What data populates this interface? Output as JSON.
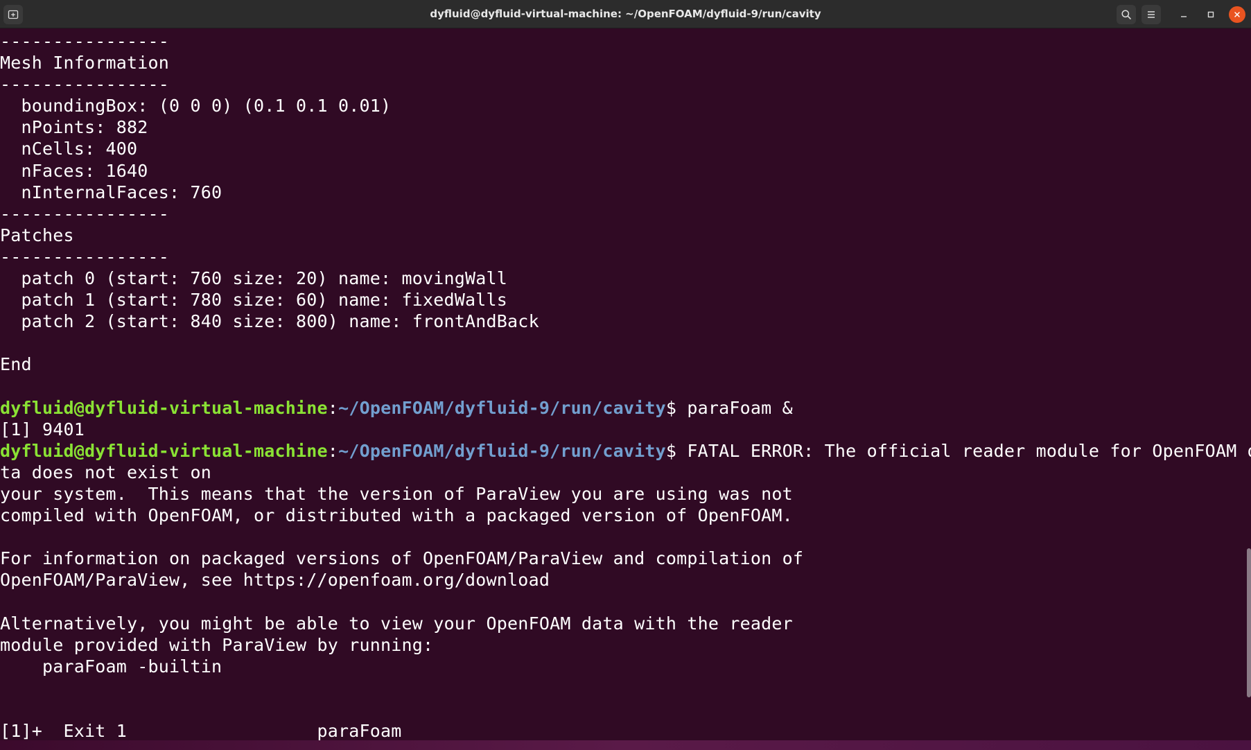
{
  "window": {
    "title": "dyfluid@dyfluid-virtual-machine: ~/OpenFOAM/dyfluid-9/run/cavity"
  },
  "titlebar": {
    "new_tab_icon": "new-tab-icon",
    "search_icon": "search-icon",
    "menu_icon": "hamburger-menu-icon",
    "minimize_icon": "minimize-icon",
    "maximize_icon": "maximize-icon",
    "close_icon": "close-icon",
    "close_color": "#e95420"
  },
  "colors": {
    "background": "#300a24",
    "text": "#ffffff",
    "prompt_user": "#8ae234",
    "prompt_path": "#729fcf"
  },
  "terminal": {
    "lines": [
      {
        "text": "----------------"
      },
      {
        "text": "Mesh Information"
      },
      {
        "text": "----------------"
      },
      {
        "text": "  boundingBox: (0 0 0) (0.1 0.1 0.01)"
      },
      {
        "text": "  nPoints: 882"
      },
      {
        "text": "  nCells: 400"
      },
      {
        "text": "  nFaces: 1640"
      },
      {
        "text": "  nInternalFaces: 760"
      },
      {
        "text": "----------------"
      },
      {
        "text": "Patches"
      },
      {
        "text": "----------------"
      },
      {
        "text": "  patch 0 (start: 760 size: 20) name: movingWall"
      },
      {
        "text": "  patch 1 (start: 780 size: 60) name: fixedWalls"
      },
      {
        "text": "  patch 2 (start: 840 size: 800) name: frontAndBack"
      },
      {
        "text": ""
      },
      {
        "text": "End"
      },
      {
        "text": ""
      },
      {
        "prompt": {
          "user": "dyfluid@dyfluid-virtual-machine",
          "sep": ":",
          "path": "~/OpenFOAM/dyfluid-9/run/cavity",
          "dollar": "$ "
        },
        "text": "paraFoam &"
      },
      {
        "text": "[1] 9401"
      },
      {
        "prompt": {
          "user": "dyfluid@dyfluid-virtual-machine",
          "sep": ":",
          "path": "~/OpenFOAM/dyfluid-9/run/cavity",
          "dollar": "$ "
        },
        "text": "FATAL ERROR: The official reader module for OpenFOAM da"
      },
      {
        "text": "ta does not exist on"
      },
      {
        "text": "your system.  This means that the version of ParaView you are using was not"
      },
      {
        "text": "compiled with OpenFOAM, or distributed with a packaged version of OpenFOAM."
      },
      {
        "text": ""
      },
      {
        "text": "For information on packaged versions of OpenFOAM/ParaView and compilation of"
      },
      {
        "text": "OpenFOAM/ParaView, see https://openfoam.org/download"
      },
      {
        "text": ""
      },
      {
        "text": "Alternatively, you might be able to view your OpenFOAM data with the reader"
      },
      {
        "text": "module provided with ParaView by running:"
      },
      {
        "text": "    paraFoam -builtin"
      },
      {
        "text": ""
      },
      {
        "text": ""
      },
      {
        "text": "[1]+  Exit 1                  paraFoam"
      }
    ]
  }
}
